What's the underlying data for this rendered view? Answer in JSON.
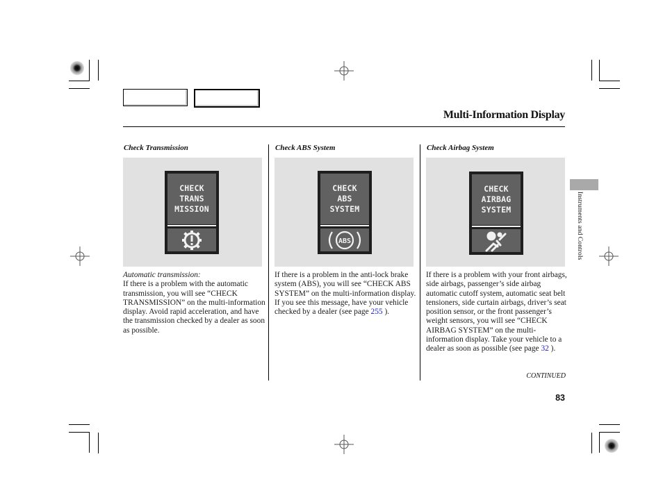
{
  "header": {
    "title": "Multi-Information Display"
  },
  "side_tab": {
    "label": "Instruments and Controls"
  },
  "columns": [
    {
      "heading": "Check Transmission",
      "display_lines": [
        "CHECK",
        "TRANS",
        "MISSION"
      ],
      "icon": "transmission-warning-icon",
      "lead": "Automatic transmission:",
      "text": "If there is a problem with the automatic transmission, you will see “CHECK TRANSMISSION” on the multi-information display. Avoid rapid acceleration, and have the transmission checked by a dealer as soon as possible."
    },
    {
      "heading": "Check ABS System",
      "display_lines": [
        "CHECK",
        "ABS",
        "SYSTEM"
      ],
      "icon": "abs-warning-icon",
      "icon_text": "ABS",
      "text": "If there is a problem in the anti-lock brake system (ABS), you will see “CHECK ABS SYSTEM” on the multi-information display. If you see this message, have your vehicle checked by a dealer (see page",
      "page_ref": "255",
      "text_end": " )."
    },
    {
      "heading": "Check Airbag System",
      "display_lines": [
        "CHECK",
        "AIRBAG",
        "SYSTEM"
      ],
      "icon": "airbag-warning-icon",
      "text": "If there is a problem with your front airbags, side airbags, passenger’s side airbag automatic cutoff system, automatic seat belt tensioners, side curtain airbags, driver’s seat position sensor, or the front passenger’s weight sensors, you will see “CHECK AIRBAG SYSTEM” on the multi-information display. Take your vehicle to a dealer as soon as possible (see page ",
      "page_ref": "32",
      "text_end": " )."
    }
  ],
  "footer": {
    "continued": "CONTINUED",
    "page_number": "83"
  },
  "colors": {
    "link": "#1a1acc",
    "panel_bg": "#e1e1e1",
    "display_bg": "#616161",
    "side_tab": "#a9a9a9"
  }
}
